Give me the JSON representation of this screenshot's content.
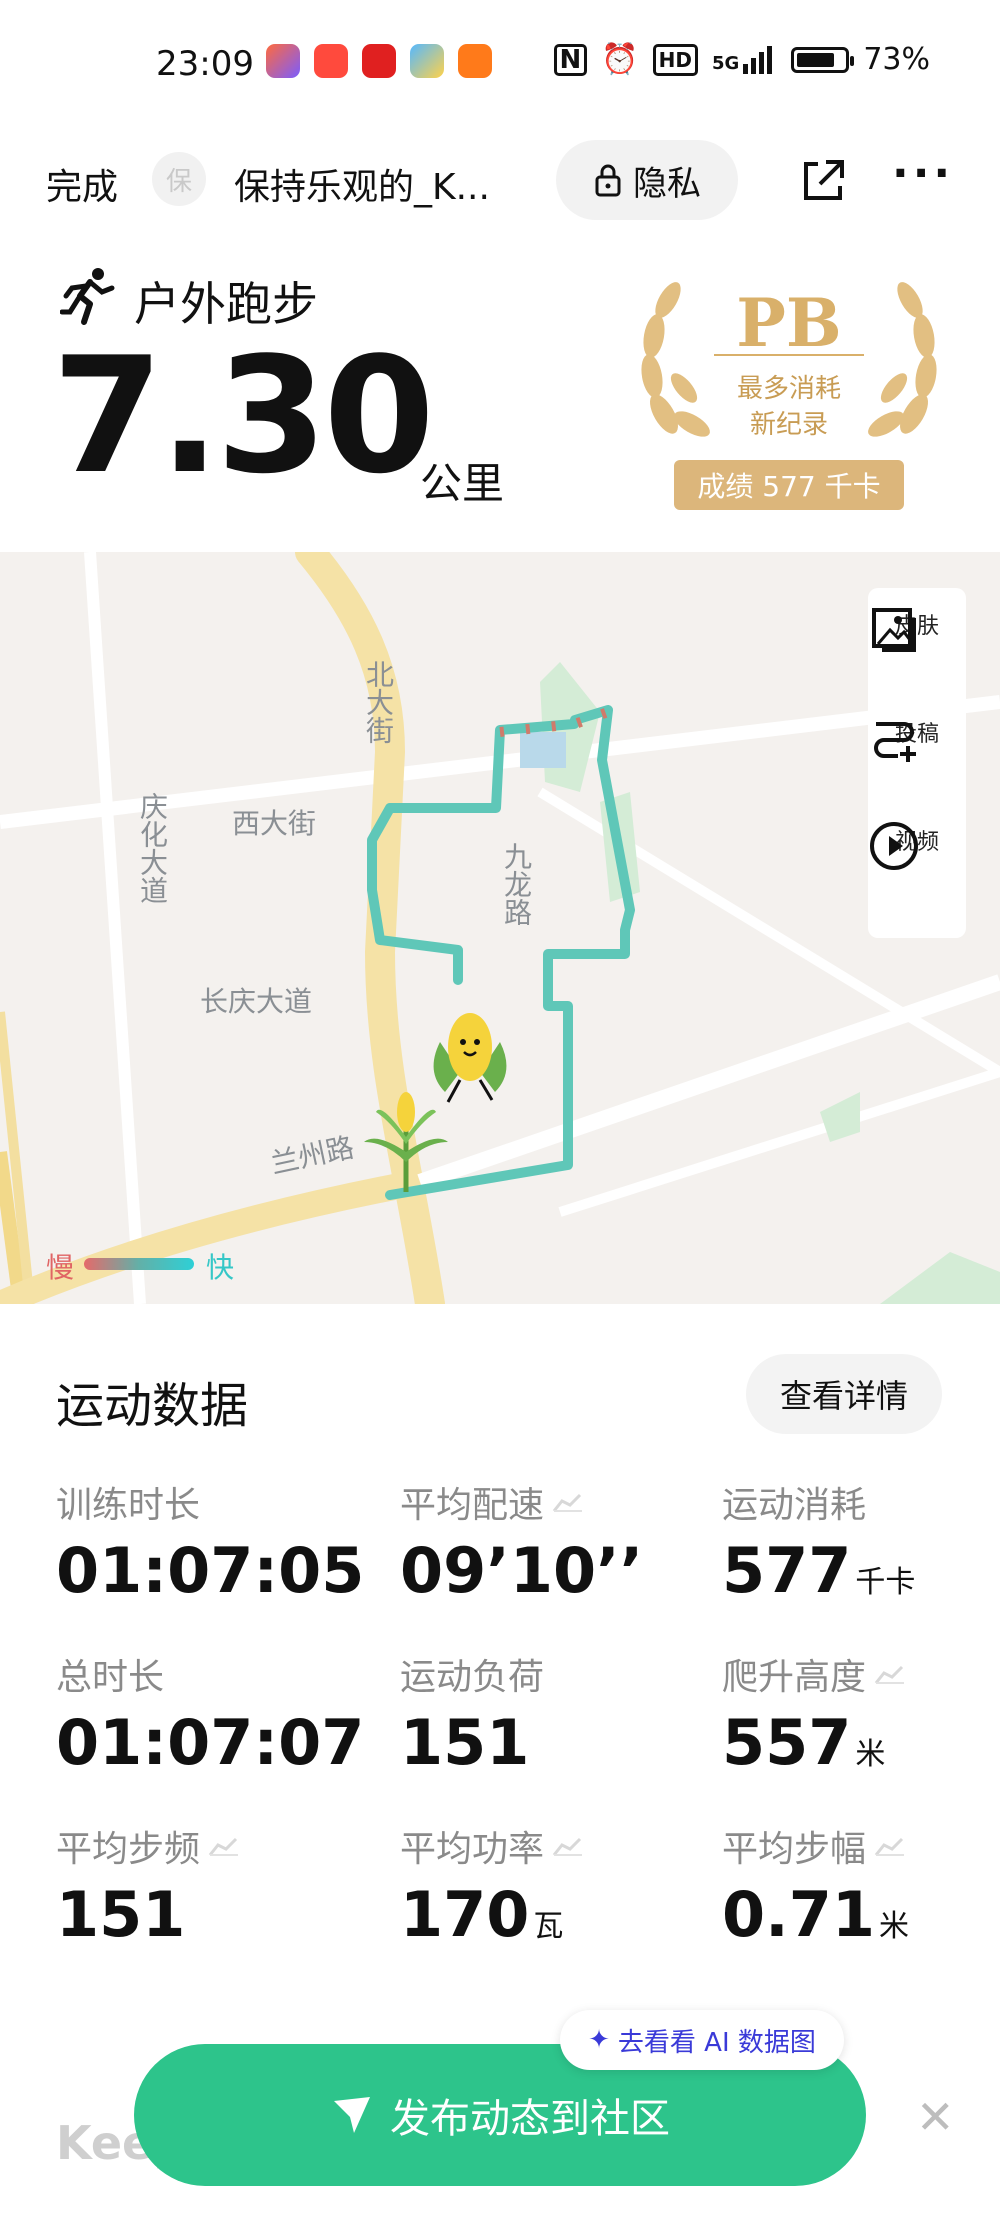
{
  "status_bar": {
    "time": "23:09",
    "signal_label": "5G",
    "battery": "73%",
    "hd_label": "HD",
    "nfc_label": "N"
  },
  "header": {
    "done_label": "完成",
    "avatar_char": "保",
    "title": "保持乐观的_K...",
    "privacy_label": "隐私"
  },
  "summary": {
    "sport_name": "户外跑步",
    "distance": "7.30",
    "distance_unit": "公里"
  },
  "pb": {
    "title": "PB",
    "line1": "最多消耗",
    "line2": "新纪录",
    "badge": "成绩 577 千卡"
  },
  "map": {
    "streets": {
      "north_street": "北大街",
      "west_street": "西大街",
      "qinghua": "庆化大道",
      "jiulong": "九龙路",
      "changqing": "长庆大道",
      "lanzhou": "兰州路"
    },
    "tools": {
      "skin": "皮肤",
      "submit": "投稿",
      "video": "视频"
    },
    "legend_slow": "慢",
    "legend_fast": "快"
  },
  "data_section": {
    "title": "运动数据",
    "detail_button": "查看详情",
    "metrics": [
      {
        "label": "训练时长",
        "value": "01:07:05",
        "unit": ""
      },
      {
        "label": "平均配速",
        "value": "09’10’’",
        "unit": ""
      },
      {
        "label": "运动消耗",
        "value": "577",
        "unit": "千卡"
      },
      {
        "label": "总时长",
        "value": "01:07:07",
        "unit": ""
      },
      {
        "label": "运动负荷",
        "value": "151",
        "unit": ""
      },
      {
        "label": "爬升高度",
        "value": "557",
        "unit": "米"
      },
      {
        "label": "平均步频",
        "value": "151",
        "unit": ""
      },
      {
        "label": "平均功率",
        "value": "170",
        "unit": "瓦"
      },
      {
        "label": "平均步幅",
        "value": "0.71",
        "unit": "米"
      }
    ]
  },
  "bottom": {
    "ai_chip": "去看看 AI 数据图",
    "keep_logo": "Keep",
    "post_button": "发布动态到社区"
  },
  "colors": {
    "accent_green": "#2dc48b",
    "pb_gold": "#d9b06a",
    "route": "#5fc7b8"
  }
}
